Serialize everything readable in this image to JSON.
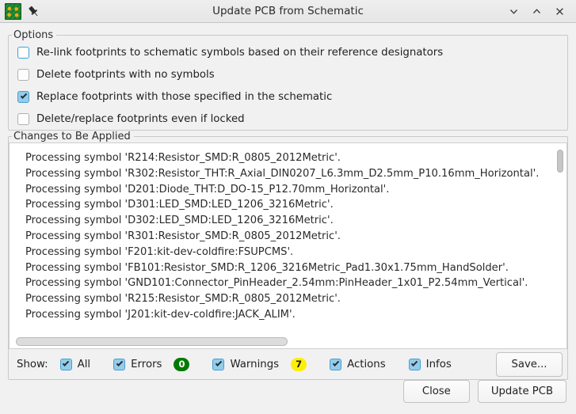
{
  "titlebar": {
    "title": "Update PCB from Schematic",
    "app_icon": "pcb-board-icon",
    "pin_icon": "pushpin-icon",
    "minimize_icon": "chevron-down-icon",
    "maximize_icon": "chevron-up-icon",
    "close_icon": "close-icon"
  },
  "options": {
    "legend": "Options",
    "items": [
      {
        "label": "Re-link footprints to schematic symbols based on their reference designators",
        "checked": false,
        "focused": true
      },
      {
        "label": "Delete footprints with no symbols",
        "checked": false,
        "focused": false
      },
      {
        "label": "Replace footprints with those specified in the schematic",
        "checked": true,
        "focused": false
      },
      {
        "label": "Delete/replace footprints even if locked",
        "checked": false,
        "focused": false
      }
    ]
  },
  "changes": {
    "legend": "Changes to Be Applied",
    "lines": [
      "Processing symbol 'R214:Resistor_SMD:R_0805_2012Metric'.",
      "Processing symbol 'R302:Resistor_THT:R_Axial_DIN0207_L6.3mm_D2.5mm_P10.16mm_Horizontal'.",
      "Processing symbol 'D201:Diode_THT:D_DO-15_P12.70mm_Horizontal'.",
      "Processing symbol 'D301:LED_SMD:LED_1206_3216Metric'.",
      "Processing symbol 'D302:LED_SMD:LED_1206_3216Metric'.",
      "Processing symbol 'R301:Resistor_SMD:R_0805_2012Metric'.",
      "Processing symbol 'F201:kit-dev-coldfire:FSUPCMS'.",
      "Processing symbol 'FB101:Resistor_SMD:R_1206_3216Metric_Pad1.30x1.75mm_HandSolder'.",
      "Processing symbol 'GND101:Connector_PinHeader_2.54mm:PinHeader_1x01_P2.54mm_Vertical'.",
      "Processing symbol 'R215:Resistor_SMD:R_0805_2012Metric'.",
      "Processing symbol 'J201:kit-dev-coldfire:JACK_ALIM'."
    ]
  },
  "show": {
    "label": "Show:",
    "filters": [
      {
        "label": "All",
        "checked": true,
        "badge": null,
        "badge_color": null
      },
      {
        "label": "Errors",
        "checked": true,
        "badge": "0",
        "badge_color": "#027a02"
      },
      {
        "label": "Warnings",
        "checked": true,
        "badge": "7",
        "badge_color": "#fbf005"
      },
      {
        "label": "Actions",
        "checked": true,
        "badge": null,
        "badge_color": null
      },
      {
        "label": "Infos",
        "checked": true,
        "badge": null,
        "badge_color": null
      }
    ],
    "save_label": "Save..."
  },
  "footer": {
    "close_label": "Close",
    "update_label": "Update PCB"
  }
}
